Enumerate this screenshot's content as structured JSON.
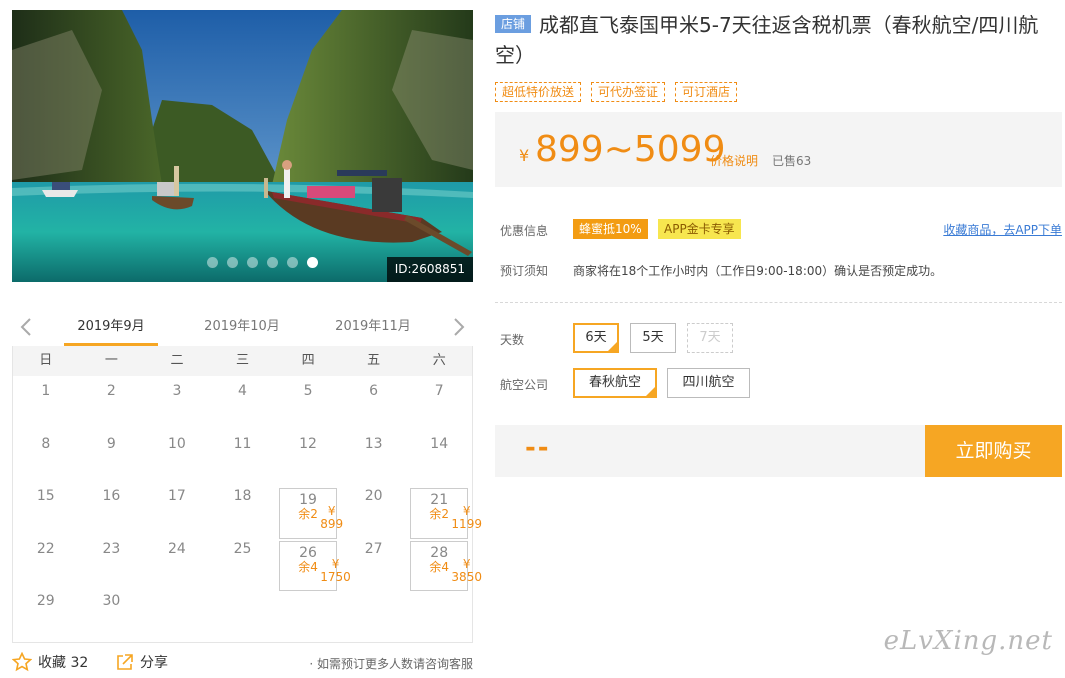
{
  "photo": {
    "id_label": "ID:2608851",
    "dots": [
      false,
      false,
      false,
      false,
      false,
      true
    ]
  },
  "calendar": {
    "months": [
      "2019年9月",
      "2019年10月",
      "2019年11月"
    ],
    "active_month": 0,
    "weekdays": [
      "日",
      "一",
      "二",
      "三",
      "四",
      "五",
      "六"
    ],
    "days": [
      {
        "d": "1"
      },
      {
        "d": "2"
      },
      {
        "d": "3"
      },
      {
        "d": "4"
      },
      {
        "d": "5"
      },
      {
        "d": "6"
      },
      {
        "d": "7"
      },
      {
        "d": "8"
      },
      {
        "d": "9"
      },
      {
        "d": "10"
      },
      {
        "d": "11"
      },
      {
        "d": "12"
      },
      {
        "d": "13"
      },
      {
        "d": "14"
      },
      {
        "d": "15"
      },
      {
        "d": "16"
      },
      {
        "d": "17"
      },
      {
        "d": "18"
      },
      {
        "d": "19",
        "price": "¥ 899",
        "left": "余2"
      },
      {
        "d": "20"
      },
      {
        "d": "21",
        "price": "¥ 1199",
        "left": "余2"
      },
      {
        "d": "22"
      },
      {
        "d": "23"
      },
      {
        "d": "24"
      },
      {
        "d": "25"
      },
      {
        "d": "26",
        "price": "¥ 1750",
        "left": "余4"
      },
      {
        "d": "27"
      },
      {
        "d": "28",
        "price": "¥ 3850",
        "left": "余4"
      },
      {
        "d": "29"
      },
      {
        "d": "30"
      }
    ]
  },
  "actions": {
    "favorite": "收藏 32",
    "share": "分享",
    "note": "· 如需预订更多人数请咨询客服"
  },
  "product": {
    "shop_badge": "店铺",
    "title": "成都直飞泰国甲米5-7天往返含税机票（春秋航空/四川航空）",
    "tags": [
      "超低特价放送",
      "可代办签证",
      "可订酒店"
    ],
    "currency": "¥",
    "price": "899~5099",
    "price_note": "价格说明",
    "sold": "已售63",
    "promo_label": "优惠信息",
    "promo1": "蜂蜜抵10%",
    "promo2": "APP金卡专享",
    "app_link": "收藏商品，去APP下单",
    "notice_label": "预订须知",
    "notice": "商家将在18个工作小时内（工作日9:00-18:00）确认是否预定成功。",
    "days_label": "天数",
    "days_options": [
      {
        "label": "6天",
        "state": "selected"
      },
      {
        "label": "5天",
        "state": "normal"
      },
      {
        "label": "7天",
        "state": "disabled"
      }
    ],
    "airline_label": "航空公司",
    "airline_options": [
      {
        "label": "春秋航空",
        "state": "selected"
      },
      {
        "label": "四川航空",
        "state": "normal"
      }
    ],
    "total": "--",
    "buy_button": "立即购买"
  },
  "watermark": "eLvXing.net",
  "colors": {
    "accent": "#f6a623",
    "price": "#f08c14",
    "link": "#3a7bd5",
    "shop_badge": "#6b9ee0"
  }
}
